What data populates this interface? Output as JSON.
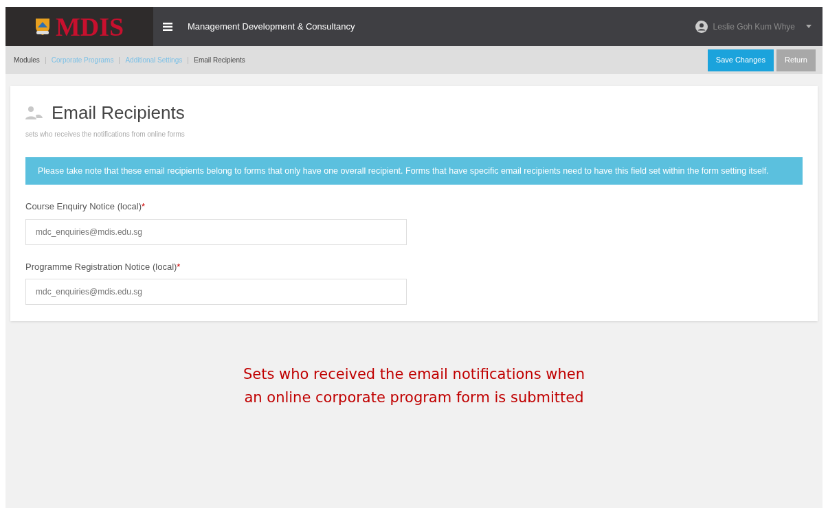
{
  "header": {
    "logo": "MDIS",
    "title": "Management Development & Consultancy",
    "user": "Leslie Goh Kum Whye"
  },
  "breadcrumb": [
    {
      "label": "Modules",
      "link": false
    },
    {
      "label": "Corporate Programs",
      "link": true
    },
    {
      "label": "Additional Settings",
      "link": true
    },
    {
      "label": "Email Recipients",
      "link": false
    }
  ],
  "actions": [
    {
      "label": "Save Changes",
      "kind": "primary"
    },
    {
      "label": "Return",
      "kind": "secondary"
    }
  ],
  "page": {
    "title": "Email Recipients",
    "subtitle": "sets who receives the notifications from online forms"
  },
  "alert": "Please take note that these email recipients belong to forms that only have one overall recipient. Forms that have specific email recipients need to have this field set within the form setting itself.",
  "fields": [
    {
      "label": "Course Enquiry Notice (local)",
      "required_mark": "*",
      "value": "mdc_enquiries@mdis.edu.sg"
    },
    {
      "label": "Programme Registration Notice (local)",
      "required_mark": "*",
      "value": "mdc_enquiries@mdis.edu.sg"
    }
  ],
  "annotation": [
    "Sets who received the email notifications when",
    "an online corporate program form is submitted"
  ]
}
